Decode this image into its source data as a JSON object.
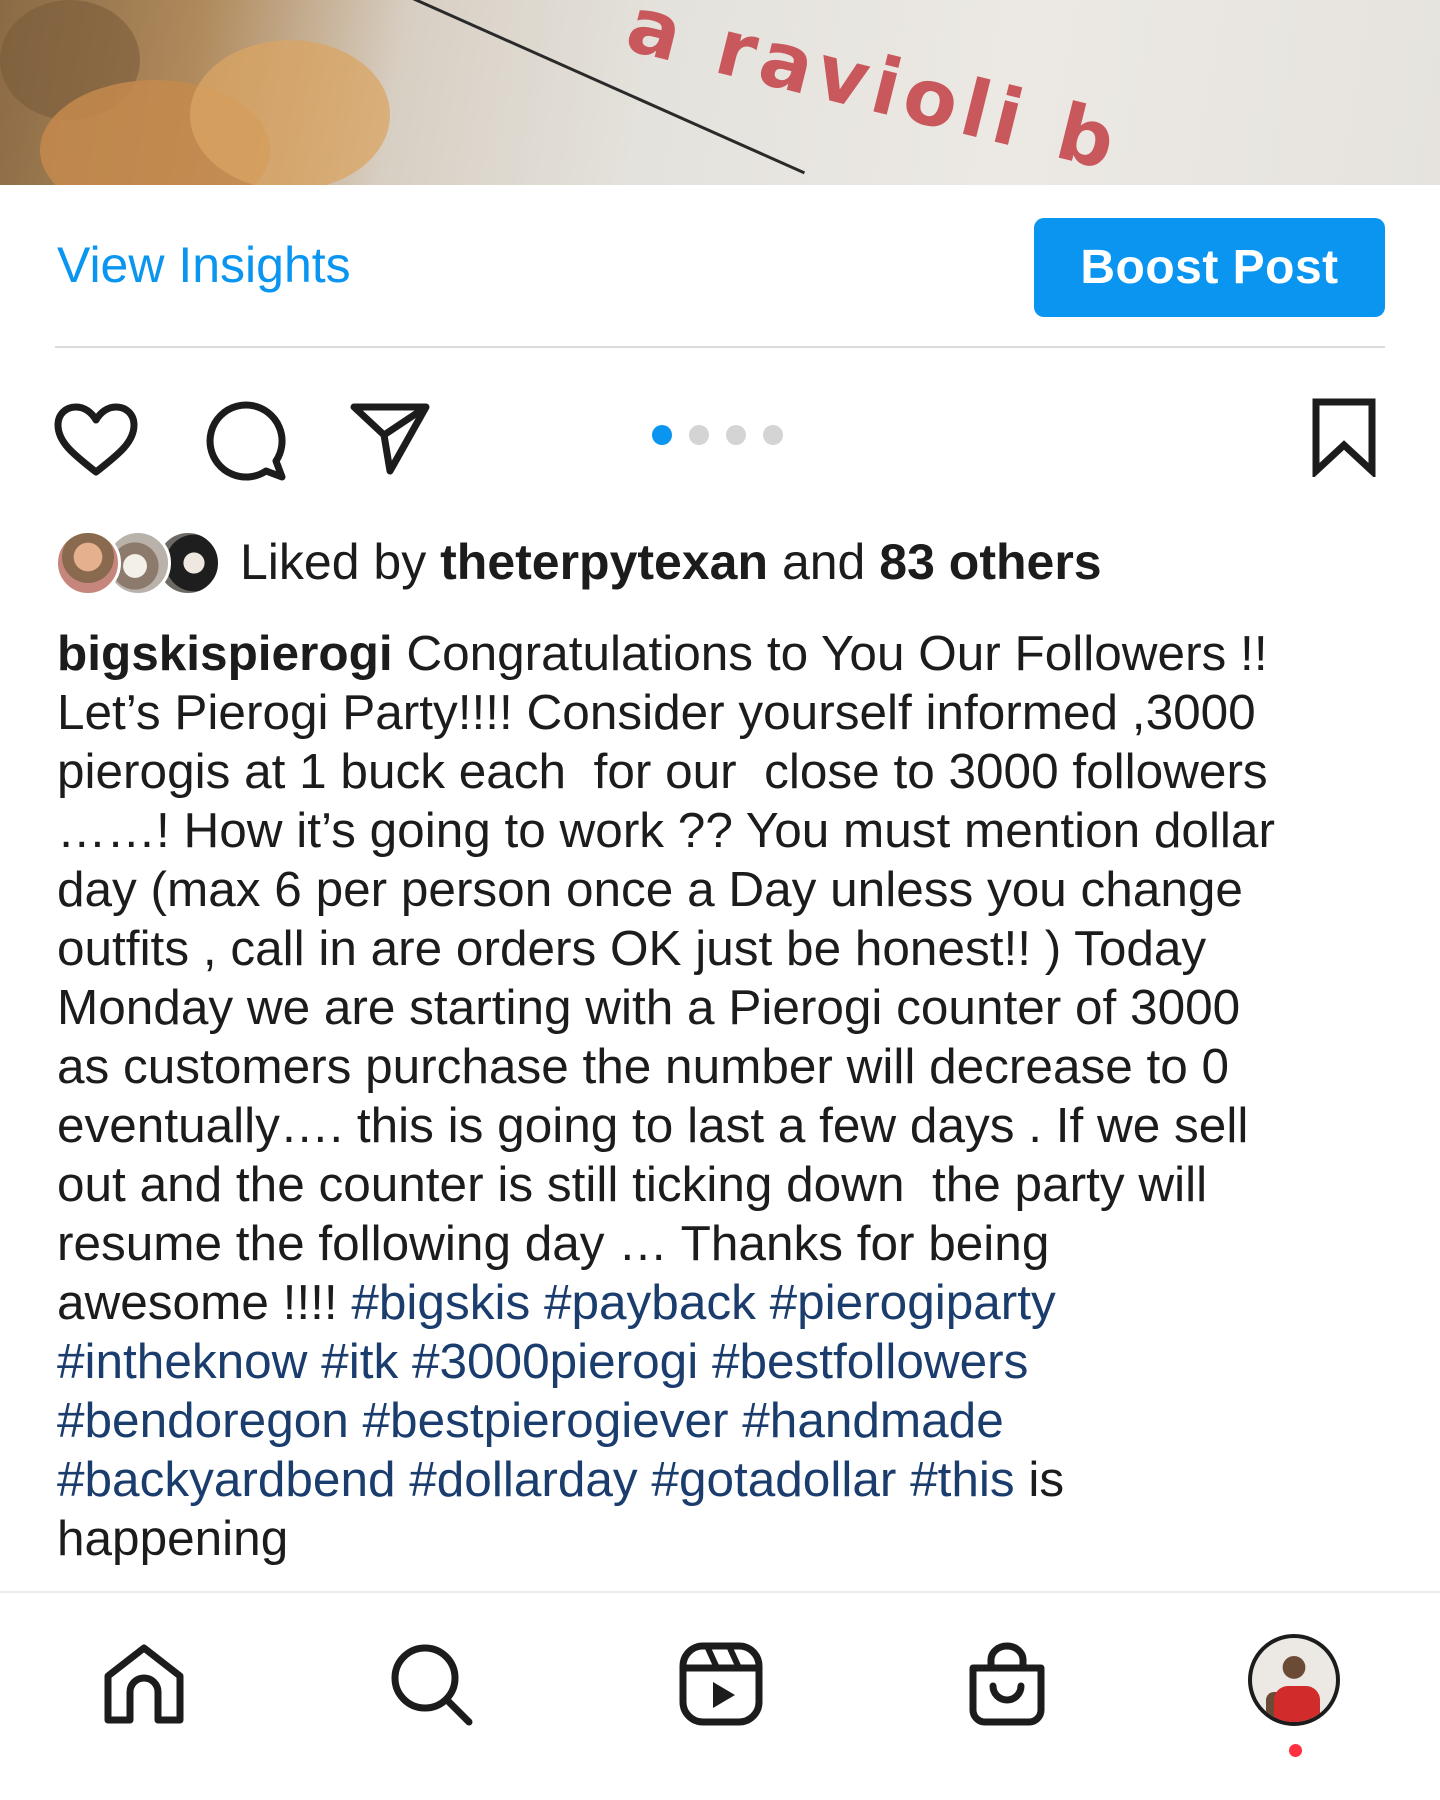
{
  "photo": {
    "printed_text": "a ravioli b"
  },
  "actions": {
    "view_insights_label": "View Insights",
    "boost_post_label": "Boost Post"
  },
  "carousel": {
    "total": 4,
    "active_index": 0
  },
  "likes": {
    "prefix": "Liked by",
    "user": "theterpytexan",
    "connector": "and",
    "others": "83 others"
  },
  "caption": {
    "username": "bigskispierogi",
    "body": "Congratulations to You Our Followers !!\nLet’s Pierogi Party!!!! Consider yourself informed ,3000\npierogis at 1 buck each  for our  close to 3000 followers\n……! How it’s going to work ?? You must mention dollar\nday (max 6 per person once a Day unless you change\noutfits , call in are orders OK just be honest!! ) Today\nMonday we are starting with a Pierogi counter of 3000\nas customers purchase the number will decrease to 0\neventually…. this is going to last a few days . If we sell\nout and the counter is still ticking down  the party will\nresume the following day … Thanks for being\nawesome !!!! ",
    "hashtags_line1": "#bigskis #payback #pierogiparty",
    "hashtags_line2": "#intheknow #itk #3000pierogi #bestfollowers",
    "hashtags_line3": "#bendoregon #bestpierogiever #handmade",
    "hashtags_line4": "#backyardbend #dollarday #gotadollar #this",
    "tail": " is\nhappening"
  },
  "colors": {
    "accent": "#0a95f0",
    "hashtag": "#1a3d6e",
    "text": "#1c1c1c",
    "notification": "#ff3040"
  },
  "icons": {
    "post_actions": [
      "heart-icon",
      "comment-icon",
      "share-icon"
    ],
    "save": "bookmark-icon",
    "nav": [
      "home-icon",
      "search-icon",
      "reels-icon",
      "shop-icon",
      "profile-avatar"
    ]
  }
}
